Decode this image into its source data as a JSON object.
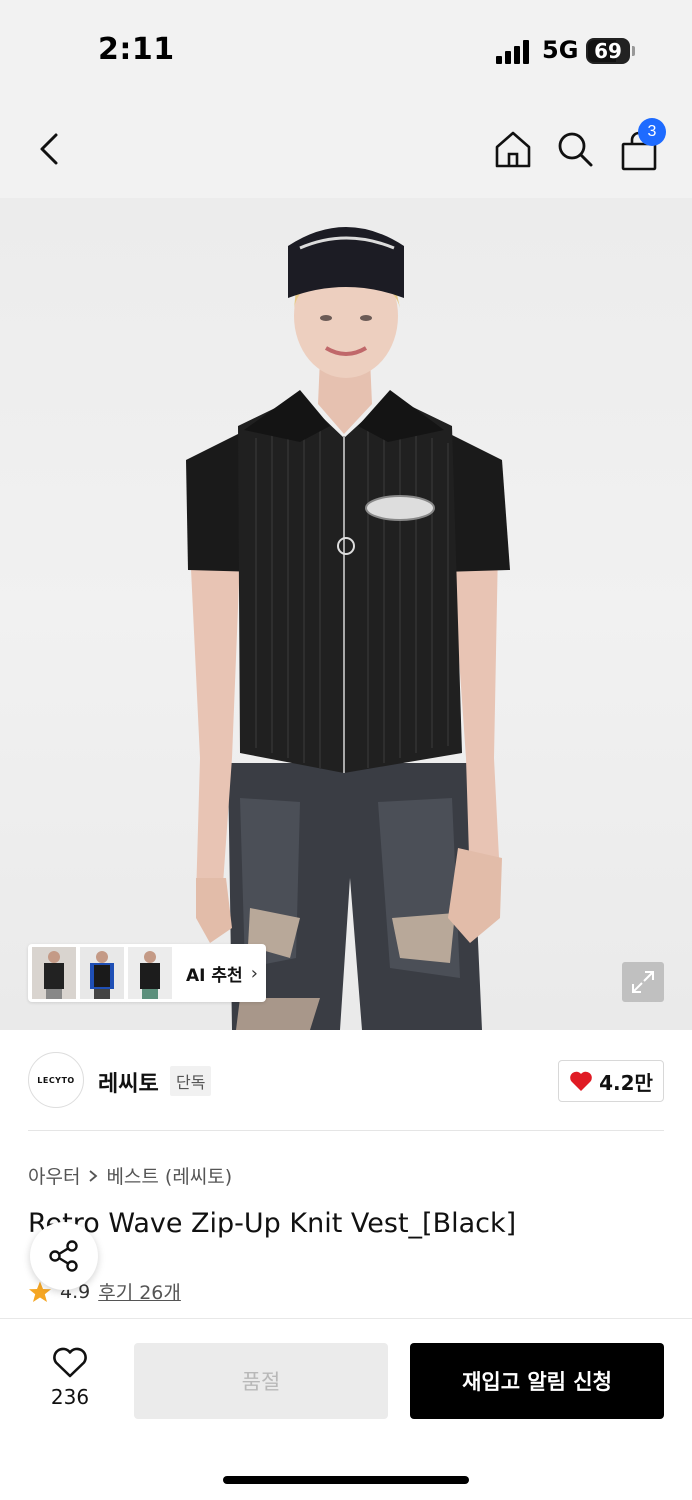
{
  "status_bar": {
    "time": "2:11",
    "network": "5G",
    "battery": "69",
    "battery_level": 0.69
  },
  "nav": {
    "back_icon": "chevron-left-icon",
    "home_icon": "home-icon",
    "search_icon": "search-icon",
    "cart_icon": "shopping-bag-icon",
    "cart_count": "3"
  },
  "hero": {
    "ai_recommend_label": "AI 추천",
    "ai_chevron": "›",
    "expand_icon": "expand-icon"
  },
  "brand": {
    "logo_text": "LECYTO",
    "name": "레씨토",
    "tag": "단독",
    "likes": "4.2만"
  },
  "product": {
    "breadcrumb": [
      "아우터",
      "베스트 (레씨토)"
    ],
    "title": "Retro Wave Zip-Up Knit Vest_[Black]",
    "rating": "4.9",
    "reviews": "후기 26개"
  },
  "bottom": {
    "wish_count": "236",
    "soldout_label": "품절",
    "notify_label": "재입고 알림 신청"
  },
  "colors": {
    "accent_blue": "#1e6bff",
    "heart_red": "#e01b24",
    "star_orange": "#f5a623"
  }
}
